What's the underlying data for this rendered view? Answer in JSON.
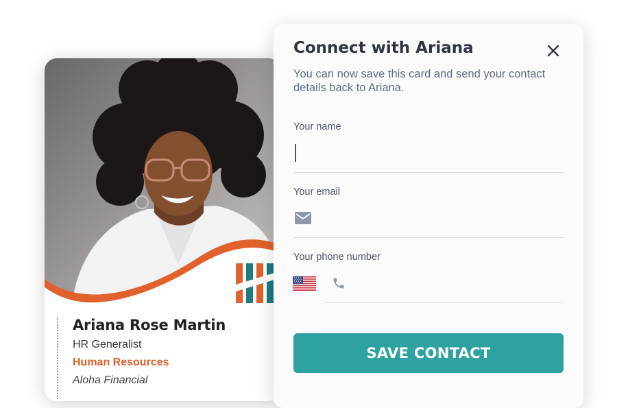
{
  "card": {
    "name": "Ariana Rose Martin",
    "job_title": "HR Generalist",
    "department": "Human Resources",
    "company": "Aloha Financial"
  },
  "modal": {
    "title": "Connect with Ariana",
    "subtitle": "You can now save this card and send your contact details back to Ariana.",
    "close_icon": "close-icon",
    "fields": {
      "name_label": "Your name",
      "name_value": "",
      "email_label": "Your email",
      "email_value": "",
      "email_icon": "envelope-icon",
      "phone_label": "Your phone number",
      "phone_value": "",
      "phone_icon": "phone-icon",
      "country_flag": "us-flag"
    },
    "save_label": "SAVE CONTACT"
  },
  "colors": {
    "accent_teal": "#2ea1a1",
    "accent_orange": "#e0612c",
    "text_dark": "#2e3440",
    "text_muted": "#5f6e85"
  }
}
